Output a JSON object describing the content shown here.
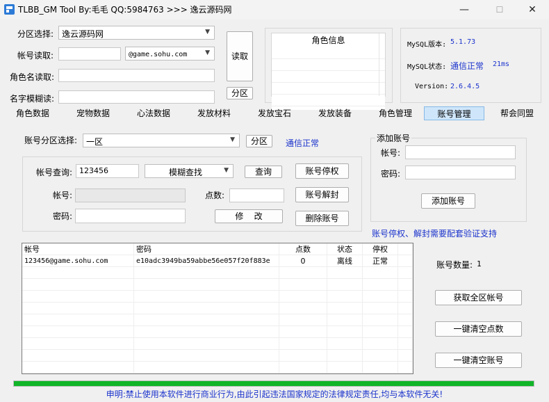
{
  "window": {
    "title": "TLBB_GM Tool By:毛毛 QQ:5984763 >>> 逸云源码网",
    "min": "—",
    "max": "☐",
    "close": "✕"
  },
  "top": {
    "zone_label": "分区选择:",
    "zone_value": "逸云源码网",
    "account_read_label": "帐号读取:",
    "account_read_value": "",
    "domain_value": "@game.sohu.com",
    "role_read_label": "角色名读取:",
    "role_read_value": "",
    "fuzzy_label": "名字模糊读:",
    "fuzzy_value": "",
    "read_button": "读取",
    "zone_button": "分区",
    "role_info_title": "角色信息",
    "mysql_version_label": "MySQL版本:",
    "mysql_version_value": "5.1.73",
    "mysql_status_label": "MySQL状态:",
    "mysql_status_value": "通信正常",
    "mysql_latency": "21ms",
    "version_label": "Version:",
    "version_value": "2.6.4.5"
  },
  "tabs": [
    "角色数据",
    "宠物数据",
    "心法数据",
    "发放材料",
    "发放宝石",
    "发放装备",
    "角色管理",
    "账号管理",
    "帮会同盟"
  ],
  "account": {
    "zone_select_label": "账号分区选择:",
    "zone_select_value": "一区",
    "zone_button": "分区",
    "status": "通信正常",
    "query_label": "帐号查询:",
    "query_value": "123456",
    "search_mode": "模糊查找",
    "query_button": "查询",
    "suspend_button": "账号停权",
    "unsuspend_button": "账号解封",
    "delete_button": "删除账号",
    "account_label": "帐号:",
    "account_value": "",
    "points_label": "点数:",
    "points_value": "",
    "password_label": "密码:",
    "password_value": "",
    "modify_button": "修    改"
  },
  "add_account": {
    "title": "添加账号",
    "account_label": "帐号:",
    "account_value": "",
    "password_label": "密码:",
    "password_value": "",
    "add_button": "添加账号",
    "note": "账号停权、解封需要配套验证支持"
  },
  "table": {
    "headers": [
      "帐号",
      "密码",
      "点数",
      "状态",
      "停权"
    ],
    "rows": [
      [
        "123456@game.sohu.com",
        "e10adc3949ba59abbe56e057f20f883e",
        "0",
        "离线",
        "正常"
      ]
    ]
  },
  "side": {
    "count_label": "账号数量:",
    "count_value": "1",
    "fetch_all_button": "获取全区帐号",
    "clear_points_button": "一键清空点数",
    "clear_accounts_button": "一键清空账号"
  },
  "progress": 1.0,
  "footer": "申明:禁止使用本软件进行商业行为,由此引起违法国家规定的法律规定责任,均与本软件无关!",
  "colors": {
    "accent_blue": "#1b33cc",
    "progress_green": "#11b528",
    "tab_active": "#cfe6fa"
  }
}
